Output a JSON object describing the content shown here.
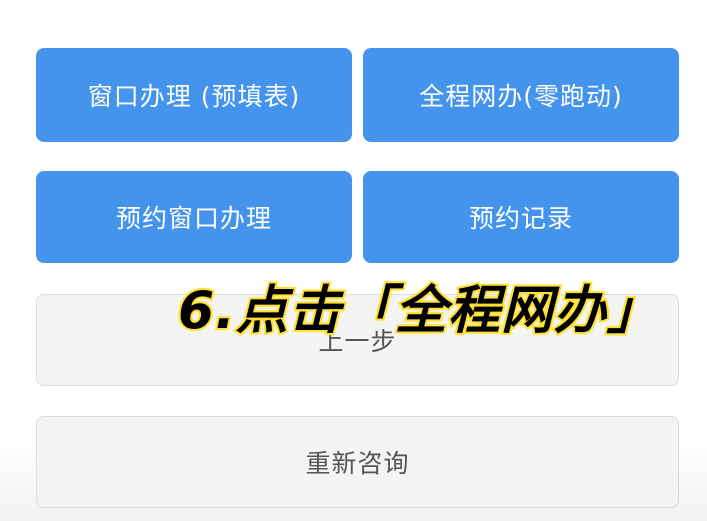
{
  "buttons": {
    "window_handle": "窗口办理 (预填表)",
    "online_handle": "全程网办(零跑动)",
    "book_window": "预约窗口办理",
    "booking_record": "预约记录",
    "previous_step": "上一步",
    "reconsult": "重新咨询"
  },
  "caption": "6.点击「全程网办」",
  "colors": {
    "primary_button": "#4494ee",
    "caption_text": "#000000",
    "caption_outline": "#ffe033"
  }
}
